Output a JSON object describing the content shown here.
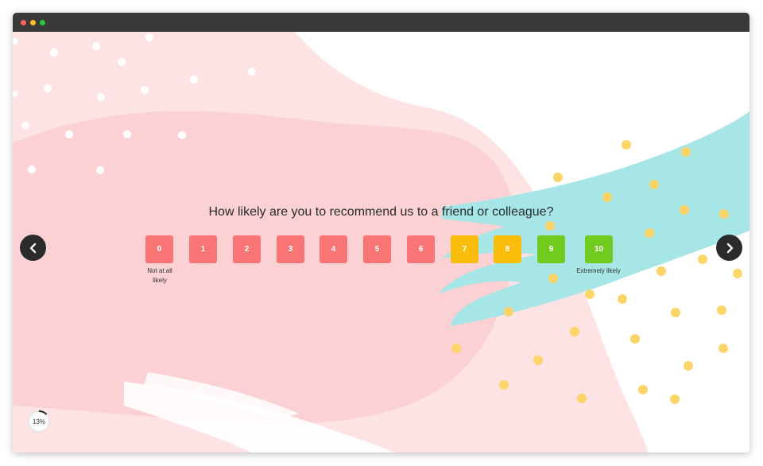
{
  "survey": {
    "question": "How likely are you to recommend us to a friend or colleague?",
    "scores": [
      {
        "label": "0",
        "color": "#f97474"
      },
      {
        "label": "1",
        "color": "#f97474"
      },
      {
        "label": "2",
        "color": "#f97474"
      },
      {
        "label": "3",
        "color": "#f97474"
      },
      {
        "label": "4",
        "color": "#f97474"
      },
      {
        "label": "5",
        "color": "#f97474"
      },
      {
        "label": "6",
        "color": "#f97474"
      },
      {
        "label": "7",
        "color": "#fbbd0c"
      },
      {
        "label": "8",
        "color": "#fbbd0c"
      },
      {
        "label": "9",
        "color": "#6fcc1f"
      },
      {
        "label": "10",
        "color": "#6fcc1f"
      }
    ],
    "low_label_line1": "Not at all",
    "low_label_line2": "likely",
    "high_label": "Extremely likely"
  },
  "progress": {
    "text": "13%",
    "fraction": 0.13
  },
  "navigation": {
    "prev_icon": "chevron-left-icon",
    "next_icon": "chevron-right-icon"
  },
  "colors": {
    "pink_light": "#fde3e4",
    "pink": "#fbd1d3",
    "teal": "#a6e6e6",
    "yellow_dot": "#fcd468",
    "nav_bg": "#2b2b2b"
  }
}
